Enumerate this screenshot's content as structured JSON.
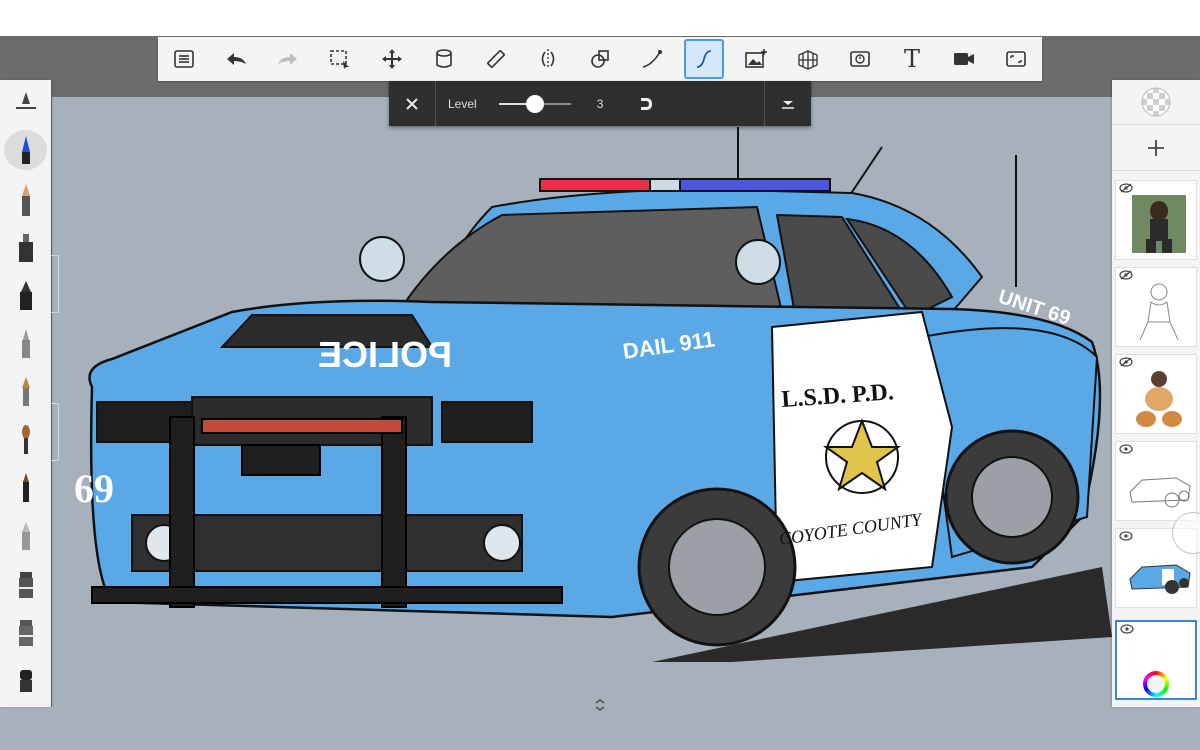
{
  "app": {
    "accent_color": "#4b9ae8",
    "canvas_background": "#a7b1bc"
  },
  "toolbar": {
    "items": [
      {
        "name": "list-icon"
      },
      {
        "name": "undo-icon"
      },
      {
        "name": "redo-icon"
      },
      {
        "name": "selection-icon"
      },
      {
        "name": "transform-icon"
      },
      {
        "name": "fill-icon"
      },
      {
        "name": "ruler-icon"
      },
      {
        "name": "symmetry-icon"
      },
      {
        "name": "shape-icon"
      },
      {
        "name": "curve-icon"
      },
      {
        "name": "predictive-stroke-icon",
        "active": true
      },
      {
        "name": "add-image-icon"
      },
      {
        "name": "perspective-icon"
      },
      {
        "name": "time-lapse-icon"
      },
      {
        "name": "text-icon",
        "label": "T"
      },
      {
        "name": "video-icon"
      },
      {
        "name": "fullscreen-icon"
      }
    ]
  },
  "level_popup": {
    "label": "Level",
    "value": "3",
    "slider_fraction": 0.5
  },
  "brushes": [
    {
      "name": "brush-settings-icon"
    },
    {
      "name": "ballpoint-pen-icon",
      "selected": true
    },
    {
      "name": "pencil-icon"
    },
    {
      "name": "marker-icon"
    },
    {
      "name": "inking-pen-icon"
    },
    {
      "name": "fine-liner-icon"
    },
    {
      "name": "calligraphy-pen-icon"
    },
    {
      "name": "paint-brush-icon"
    },
    {
      "name": "airbrush-icon"
    },
    {
      "name": "felt-tip-icon"
    },
    {
      "name": "chisel-marker-icon"
    },
    {
      "name": "flat-marker-icon"
    },
    {
      "name": "eraser-icon"
    }
  ],
  "layers": [
    {
      "name": "layer-1",
      "visible": false,
      "thumb": "character-dark"
    },
    {
      "name": "layer-2",
      "visible": false,
      "thumb": "sketch"
    },
    {
      "name": "layer-3",
      "visible": false,
      "thumb": "character-tiger"
    },
    {
      "name": "layer-4",
      "visible": true,
      "thumb": "car-lineart"
    },
    {
      "name": "layer-5",
      "visible": true,
      "thumb": "car-color"
    },
    {
      "name": "layer-6",
      "visible": true,
      "thumb": "blank",
      "selected": true
    }
  ],
  "artwork": {
    "hood_text": "POLICE",
    "fender_text": "DAIL 911",
    "door_text": "L.S.D.   P.D.",
    "door_banner": "COYOTE COUNTY",
    "number": "69",
    "rear_text": "UNIT 69",
    "body_color": "#5aa8e6",
    "door_color": "#ffffff",
    "star_color": "#e0c54a",
    "lightbar_red": "#e2334a",
    "lightbar_blue": "#4a55e0"
  }
}
